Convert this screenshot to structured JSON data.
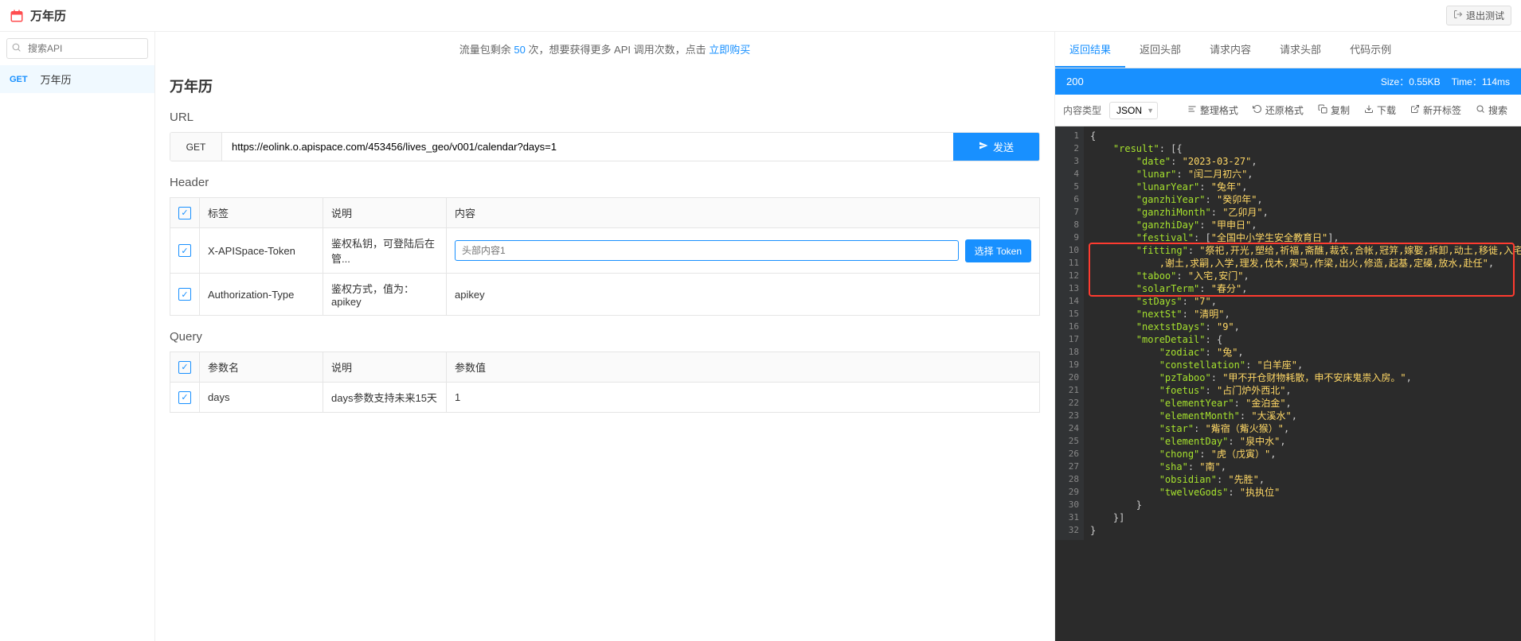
{
  "app": {
    "title": "万年历",
    "exit_label": "退出测试"
  },
  "sidebar": {
    "search_placeholder": "搜索API",
    "api": {
      "method": "GET",
      "name": "万年历"
    }
  },
  "notice": {
    "pre": "流量包剩余 ",
    "count": "50",
    "mid": " 次，想要获得更多 API 调用次数，点击 ",
    "link": "立即购买"
  },
  "main": {
    "title": "万年历",
    "url_label": "URL",
    "method": "GET",
    "url": "https://eolink.o.apispace.com/453456/lives_geo/v001/calendar?days=1",
    "send": "发送",
    "header_label": "Header",
    "query_label": "Query",
    "cols": {
      "tag": "标签",
      "desc": "说明",
      "content": "内容"
    },
    "query_cols": {
      "name": "参数名",
      "desc": "说明",
      "value": "参数值"
    },
    "headers": [
      {
        "tag": "X-APISpace-Token",
        "desc": "鉴权私钥，可登陆后在管...",
        "placeholder": "头部内容1",
        "button": "选择 Token"
      },
      {
        "tag": "Authorization-Type",
        "desc": "鉴权方式，值为：apikey",
        "value": "apikey"
      }
    ],
    "query": [
      {
        "name": "days",
        "desc": "days参数支持未来15天",
        "value": "1"
      }
    ]
  },
  "result": {
    "tabs": [
      "返回结果",
      "返回头部",
      "请求内容",
      "请求头部",
      "代码示例"
    ],
    "status": "200",
    "size_label": "Size：",
    "size": "0.55KB",
    "time_label": "Time：",
    "time": "114ms",
    "toolbar": {
      "type_label": "内容类型",
      "type_value": "JSON",
      "format": "整理格式",
      "restore": "还原格式",
      "copy": "复制",
      "download": "下载",
      "newtab": "新开标签",
      "search": "搜索"
    },
    "lines": [
      [
        [
          "p",
          "{"
        ]
      ],
      [
        [
          "p",
          "    "
        ],
        [
          "k",
          "\"result\""
        ],
        [
          "p",
          ":"
        ],
        [
          "p",
          " [{"
        ]
      ],
      [
        [
          "p",
          "        "
        ],
        [
          "k",
          "\"date\""
        ],
        [
          "p",
          ":"
        ],
        [
          "p",
          " "
        ],
        [
          "s",
          "\"2023-03-27\""
        ],
        [
          "p",
          ","
        ]
      ],
      [
        [
          "p",
          "        "
        ],
        [
          "k",
          "\"lunar\""
        ],
        [
          "p",
          ":"
        ],
        [
          "p",
          " "
        ],
        [
          "s",
          "\"闰二月初六\""
        ],
        [
          "p",
          ","
        ]
      ],
      [
        [
          "p",
          "        "
        ],
        [
          "k",
          "\"lunarYear\""
        ],
        [
          "p",
          ":"
        ],
        [
          "p",
          " "
        ],
        [
          "s",
          "\"兔年\""
        ],
        [
          "p",
          ","
        ]
      ],
      [
        [
          "p",
          "        "
        ],
        [
          "k",
          "\"ganzhiYear\""
        ],
        [
          "p",
          ":"
        ],
        [
          "p",
          " "
        ],
        [
          "s",
          "\"癸卯年\""
        ],
        [
          "p",
          ","
        ]
      ],
      [
        [
          "p",
          "        "
        ],
        [
          "k",
          "\"ganzhiMonth\""
        ],
        [
          "p",
          ":"
        ],
        [
          "p",
          " "
        ],
        [
          "s",
          "\"乙卯月\""
        ],
        [
          "p",
          ","
        ]
      ],
      [
        [
          "p",
          "        "
        ],
        [
          "k",
          "\"ganzhiDay\""
        ],
        [
          "p",
          ":"
        ],
        [
          "p",
          " "
        ],
        [
          "s",
          "\"甲申日\""
        ],
        [
          "p",
          ","
        ]
      ],
      [
        [
          "p",
          "        "
        ],
        [
          "k",
          "\"festival\""
        ],
        [
          "p",
          ":"
        ],
        [
          "p",
          " ["
        ],
        [
          "s",
          "\"全国中小学生安全教育日\""
        ],
        [
          "p",
          "],"
        ]
      ],
      [
        [
          "p",
          "        "
        ],
        [
          "k",
          "\"fitting\""
        ],
        [
          "p",
          ":"
        ],
        [
          "p",
          " "
        ],
        [
          "s",
          "\"祭祀,开光,塑给,祈福,斋醮,裁衣,合帐,冠笄,嫁娶,拆卸,动土,移徙,入宅,入殓,移柩,安葬"
        ]
      ],
      [
        [
          "p",
          "            "
        ],
        [
          "s",
          ",谢土,求嗣,入学,理发,伐木,架马,作梁,出火,修造,起基,定磉,放水,赴任\""
        ],
        [
          "p",
          ","
        ]
      ],
      [
        [
          "p",
          "        "
        ],
        [
          "k",
          "\"taboo\""
        ],
        [
          "p",
          ":"
        ],
        [
          "p",
          " "
        ],
        [
          "s",
          "\"入宅,安门\""
        ],
        [
          "p",
          ","
        ]
      ],
      [
        [
          "p",
          "        "
        ],
        [
          "k",
          "\"solarTerm\""
        ],
        [
          "p",
          ":"
        ],
        [
          "p",
          " "
        ],
        [
          "s",
          "\"春分\""
        ],
        [
          "p",
          ","
        ]
      ],
      [
        [
          "p",
          "        "
        ],
        [
          "k",
          "\"stDays\""
        ],
        [
          "p",
          ":"
        ],
        [
          "p",
          " "
        ],
        [
          "s",
          "\"7\""
        ],
        [
          "p",
          ","
        ]
      ],
      [
        [
          "p",
          "        "
        ],
        [
          "k",
          "\"nextSt\""
        ],
        [
          "p",
          ":"
        ],
        [
          "p",
          " "
        ],
        [
          "s",
          "\"清明\""
        ],
        [
          "p",
          ","
        ]
      ],
      [
        [
          "p",
          "        "
        ],
        [
          "k",
          "\"nextstDays\""
        ],
        [
          "p",
          ":"
        ],
        [
          "p",
          " "
        ],
        [
          "s",
          "\"9\""
        ],
        [
          "p",
          ","
        ]
      ],
      [
        [
          "p",
          "        "
        ],
        [
          "k",
          "\"moreDetail\""
        ],
        [
          "p",
          ":"
        ],
        [
          "p",
          " {"
        ]
      ],
      [
        [
          "p",
          "            "
        ],
        [
          "k",
          "\"zodiac\""
        ],
        [
          "p",
          ":"
        ],
        [
          "p",
          " "
        ],
        [
          "s",
          "\"兔\""
        ],
        [
          "p",
          ","
        ]
      ],
      [
        [
          "p",
          "            "
        ],
        [
          "k",
          "\"constellation\""
        ],
        [
          "p",
          ":"
        ],
        [
          "p",
          " "
        ],
        [
          "s",
          "\"白羊座\""
        ],
        [
          "p",
          ","
        ]
      ],
      [
        [
          "p",
          "            "
        ],
        [
          "k",
          "\"pzTaboo\""
        ],
        [
          "p",
          ":"
        ],
        [
          "p",
          " "
        ],
        [
          "s",
          "\"甲不开仓财物耗散，申不安床鬼祟入房。\""
        ],
        [
          "p",
          ","
        ]
      ],
      [
        [
          "p",
          "            "
        ],
        [
          "k",
          "\"foetus\""
        ],
        [
          "p",
          ":"
        ],
        [
          "p",
          " "
        ],
        [
          "s",
          "\"占门炉外西北\""
        ],
        [
          "p",
          ","
        ]
      ],
      [
        [
          "p",
          "            "
        ],
        [
          "k",
          "\"elementYear\""
        ],
        [
          "p",
          ":"
        ],
        [
          "p",
          " "
        ],
        [
          "s",
          "\"金泊金\""
        ],
        [
          "p",
          ","
        ]
      ],
      [
        [
          "p",
          "            "
        ],
        [
          "k",
          "\"elementMonth\""
        ],
        [
          "p",
          ":"
        ],
        [
          "p",
          " "
        ],
        [
          "s",
          "\"大溪水\""
        ],
        [
          "p",
          ","
        ]
      ],
      [
        [
          "p",
          "            "
        ],
        [
          "k",
          "\"star\""
        ],
        [
          "p",
          ":"
        ],
        [
          "p",
          " "
        ],
        [
          "s",
          "\"觜宿（觜火猴）\""
        ],
        [
          "p",
          ","
        ]
      ],
      [
        [
          "p",
          "            "
        ],
        [
          "k",
          "\"elementDay\""
        ],
        [
          "p",
          ":"
        ],
        [
          "p",
          " "
        ],
        [
          "s",
          "\"泉中水\""
        ],
        [
          "p",
          ","
        ]
      ],
      [
        [
          "p",
          "            "
        ],
        [
          "k",
          "\"chong\""
        ],
        [
          "p",
          ":"
        ],
        [
          "p",
          " "
        ],
        [
          "s",
          "\"虎（戊寅）\""
        ],
        [
          "p",
          ","
        ]
      ],
      [
        [
          "p",
          "            "
        ],
        [
          "k",
          "\"sha\""
        ],
        [
          "p",
          ":"
        ],
        [
          "p",
          " "
        ],
        [
          "s",
          "\"南\""
        ],
        [
          "p",
          ","
        ]
      ],
      [
        [
          "p",
          "            "
        ],
        [
          "k",
          "\"obsidian\""
        ],
        [
          "p",
          ":"
        ],
        [
          "p",
          " "
        ],
        [
          "s",
          "\"先胜\""
        ],
        [
          "p",
          ","
        ]
      ],
      [
        [
          "p",
          "            "
        ],
        [
          "k",
          "\"twelveGods\""
        ],
        [
          "p",
          ":"
        ],
        [
          "p",
          " "
        ],
        [
          "s",
          "\"执执位\""
        ]
      ],
      [
        [
          "p",
          "        }"
        ]
      ],
      [
        [
          "p",
          "    }]"
        ]
      ],
      [
        [
          "p",
          "}"
        ]
      ]
    ],
    "highlight": {
      "start": 9,
      "end": 12
    }
  }
}
